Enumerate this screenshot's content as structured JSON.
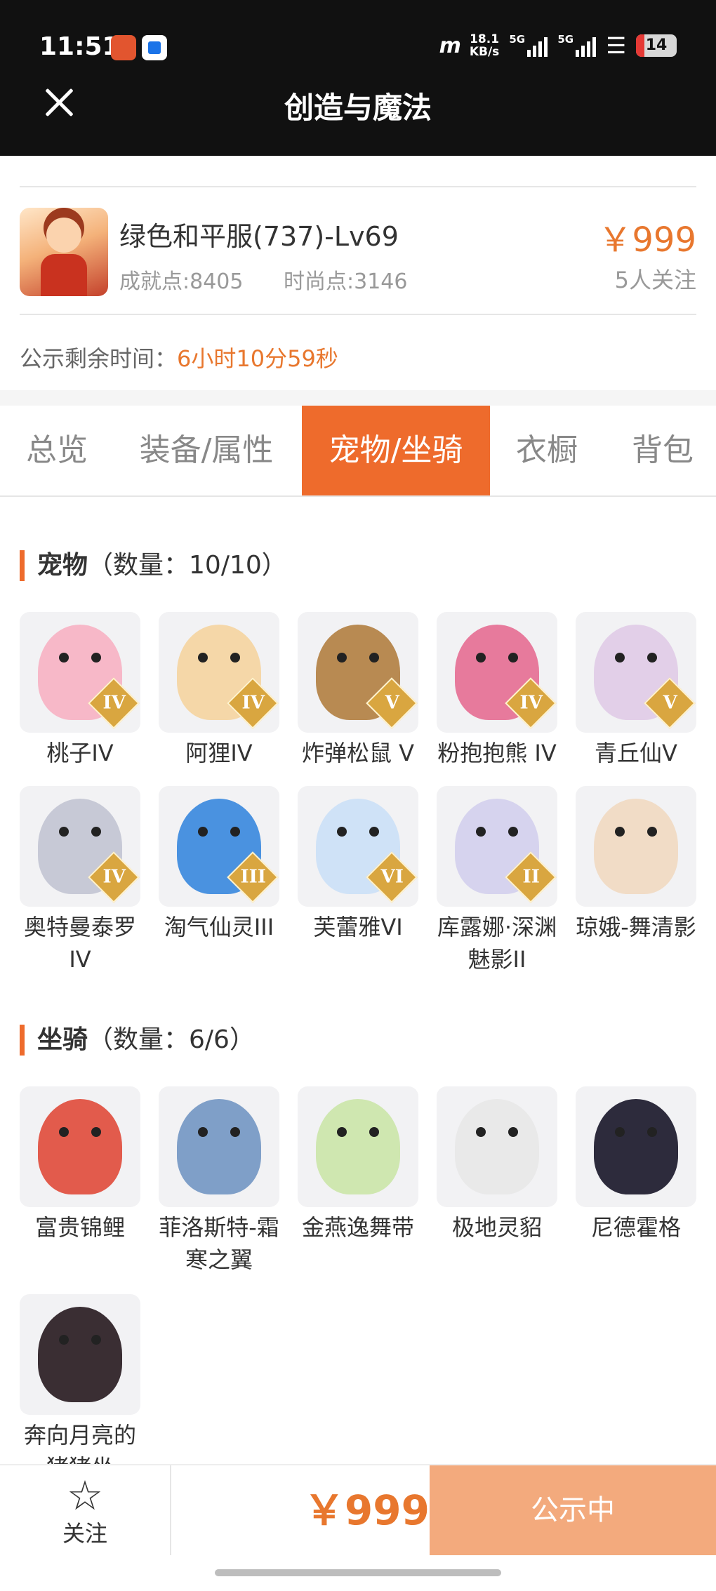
{
  "status_bar": {
    "time": "11:51",
    "carrier_logo": "m",
    "speed_value": "18.1",
    "speed_unit": "KB/s",
    "sig1_label": "5G",
    "sig2_label": "5G",
    "battery": "14",
    "wifi_icon": "wifi-icon"
  },
  "header": {
    "title": "创造与魔法"
  },
  "product": {
    "name": "绿色和平服(737)-Lv69",
    "achievement": "成就点:8405",
    "fashion": "时尚点:3146",
    "price": "￥999",
    "followers": "5人关注",
    "notice_label": "公示剩余时间：",
    "notice_time": "6小时10分59秒"
  },
  "tabs": [
    {
      "label": "总览",
      "active": false
    },
    {
      "label": "装备/属性",
      "active": false
    },
    {
      "label": "宠物/坐骑",
      "active": true
    },
    {
      "label": "衣橱",
      "active": false
    },
    {
      "label": "背包",
      "active": false
    }
  ],
  "pets": {
    "title": "宠物",
    "count": "（数量：10/10）",
    "items": [
      {
        "label": "桃子IV",
        "badge": "IV",
        "color": "#f7b8c8"
      },
      {
        "label": "阿狸IV",
        "badge": "IV",
        "color": "#f5d7a8"
      },
      {
        "label": "炸弹松鼠 V",
        "badge": "V",
        "color": "#b88a52"
      },
      {
        "label": "粉抱抱熊 IV",
        "badge": "IV",
        "color": "#e77a9c"
      },
      {
        "label": "青丘仙V",
        "badge": "V",
        "color": "#e2cfe8"
      },
      {
        "label": "奥特曼泰罗IV",
        "badge": "IV",
        "color": "#c7c9d6"
      },
      {
        "label": "淘气仙灵III",
        "badge": "III",
        "color": "#4a92e0"
      },
      {
        "label": "芙蕾雅VI",
        "badge": "VI",
        "color": "#cfe2f7"
      },
      {
        "label": "库露娜·深渊魅影II",
        "badge": "II",
        "color": "#d6d3ee"
      },
      {
        "label": "琼娥-舞清影",
        "badge": "",
        "color": "#f1dcc6"
      }
    ]
  },
  "mounts": {
    "title": "坐骑",
    "count": "（数量：6/6）",
    "items": [
      {
        "label": "富贵锦鲤",
        "color": "#e25b4c"
      },
      {
        "label": "菲洛斯特-霜寒之翼",
        "color": "#7f9fc8"
      },
      {
        "label": "金燕逸舞带",
        "color": "#cfe7b0"
      },
      {
        "label": "极地灵貂",
        "color": "#e9e9e9"
      },
      {
        "label": "尼德霍格",
        "color": "#2d2b3c"
      },
      {
        "label": "奔向月亮的猪猪坐",
        "color": "#3a2e33"
      }
    ]
  },
  "bottom_bar": {
    "follow_label": "关注",
    "follow_icon": "star-icon",
    "price": "￥999",
    "status_button": "公示中"
  },
  "colors": {
    "accent": "#ee6b2c",
    "price": "#e8772e",
    "announce_button": "#f3aa7d"
  }
}
